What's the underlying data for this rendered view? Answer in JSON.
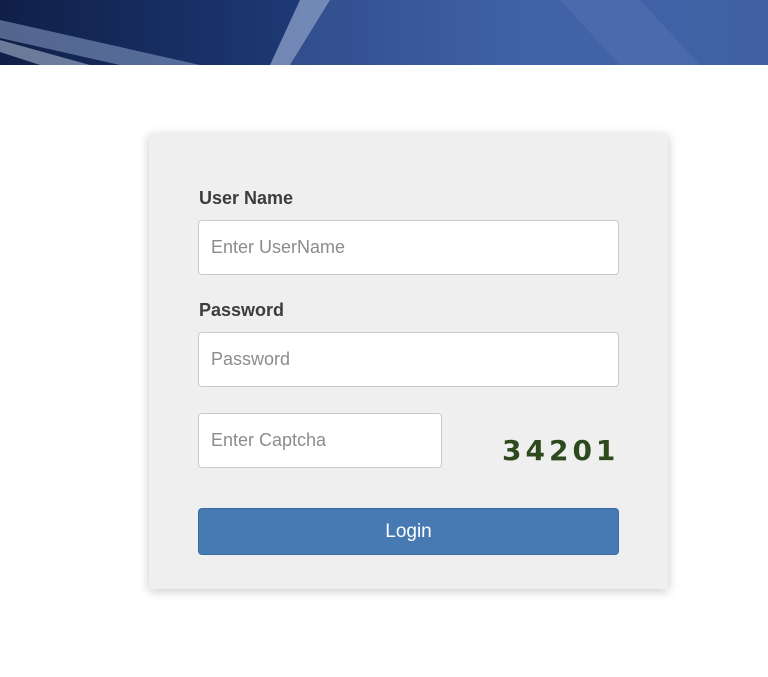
{
  "banner": {
    "colors": [
      "#0f1f47",
      "#1f3a78",
      "#3b5ea8"
    ]
  },
  "form": {
    "username_label": "User Name",
    "username_placeholder": "Enter UserName",
    "password_label": "Password",
    "password_placeholder": "Password",
    "captcha_placeholder": "Enter Captcha",
    "captcha_code": "34201",
    "login_label": "Login"
  },
  "colors": {
    "login_button": "#4779b3",
    "captcha_text": "#2d4a1e",
    "card_background": "#efefef"
  }
}
